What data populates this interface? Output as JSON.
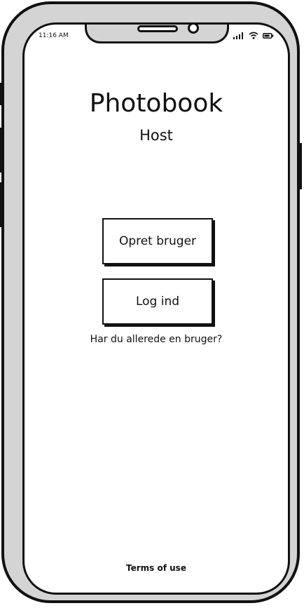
{
  "status_bar": {
    "time": "11:16 AM",
    "icons": [
      "signal-icon",
      "wifi-icon",
      "battery-icon"
    ]
  },
  "app": {
    "title": "Photobook",
    "subtitle": "Host"
  },
  "buttons": {
    "create_account": "Opret bruger",
    "login": "Log ind"
  },
  "hint_text": "Har du allerede en bruger?",
  "footer": {
    "terms": "Terms of use"
  },
  "colors": {
    "frame": "#d4d4d4",
    "ink": "#111111",
    "screen": "#ffffff"
  }
}
